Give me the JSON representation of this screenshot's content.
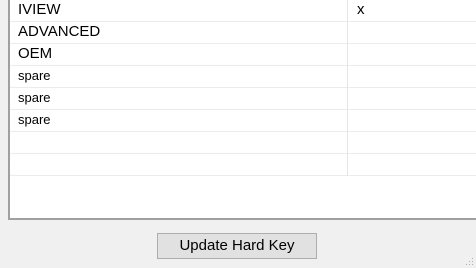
{
  "grid": {
    "rows": [
      {
        "name": "IVIEW",
        "value": "x",
        "size": "big"
      },
      {
        "name": "ADVANCED",
        "value": "",
        "size": "big"
      },
      {
        "name": "OEM",
        "value": "",
        "size": "big"
      },
      {
        "name": "spare",
        "value": "",
        "size": "small"
      },
      {
        "name": "spare",
        "value": "",
        "size": "small"
      },
      {
        "name": "spare",
        "value": "",
        "size": "small"
      },
      {
        "name": "",
        "value": "",
        "size": "small"
      },
      {
        "name": "",
        "value": "",
        "size": "small"
      }
    ]
  },
  "footer": {
    "update_button_label": "Update Hard Key"
  },
  "colors": {
    "window_bg": "#f0f0f0",
    "grid_bg": "#ffffff",
    "button_bg": "#e1e1e1",
    "button_border": "#adadad"
  }
}
